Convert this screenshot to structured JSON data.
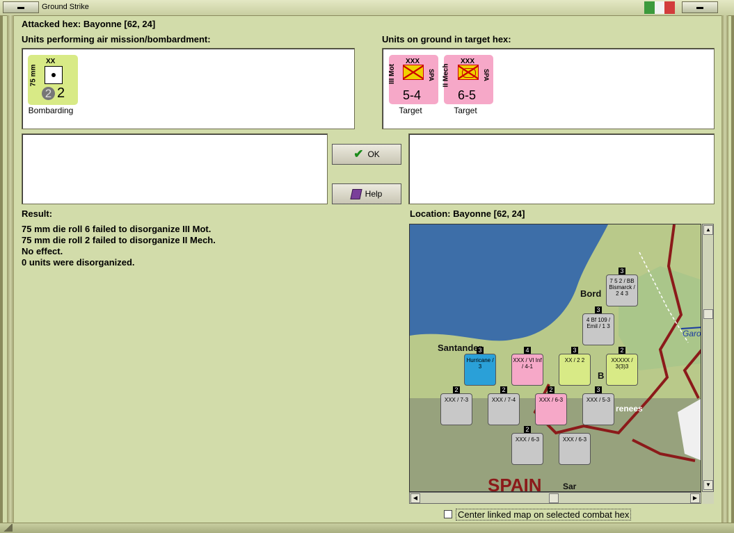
{
  "window": {
    "title": "Ground Strike"
  },
  "header": {
    "attacked_hex": "Attacked hex: Bayonne  [62, 24]"
  },
  "air_panel": {
    "label": "Units performing air mission/bombardment:",
    "units": [
      {
        "size": "XX",
        "side_label": "75 mm",
        "value_circle": "2",
        "value": "2",
        "caption": "Bombarding",
        "color": "#d8ea86"
      }
    ]
  },
  "ground_panel": {
    "label": "Units on ground in target hex:",
    "units": [
      {
        "size": "XXX",
        "name": "III Mot",
        "nation": "SPA",
        "combat": "5-4",
        "caption": "Target",
        "color": "#f6a8c8"
      },
      {
        "size": "XXX",
        "name": "II Mech",
        "nation": "SPA",
        "combat": "6-5",
        "caption": "Target",
        "color": "#f6a8c8"
      }
    ]
  },
  "buttons": {
    "ok": "OK",
    "help": "Help"
  },
  "result": {
    "label": "Result:",
    "lines": [
      "75 mm die roll 6 failed to disorganize III Mot.",
      "75 mm die roll 2 failed to disorganize II Mech.",
      "No effect.",
      "0 units were disorganized."
    ]
  },
  "location": {
    "label": "Location:  Bayonne  [62, 24]",
    "map_labels": {
      "bordeaux": "Bord",
      "santander": "Santander",
      "pyrenees": "renees",
      "spain": "SPAIN",
      "garonne": "Garo",
      "sar": "Sar",
      "b": "B"
    },
    "map_units": [
      {
        "top": "3",
        "text": "7 5 2 / BB Bismarck / 2 4 3",
        "color": "#c8c8c8"
      },
      {
        "top": "3",
        "text": "4 Bf 109 / Emil / 1 3",
        "color": "#c8c8c8"
      },
      {
        "top": "3",
        "text": "Hurricane / 3",
        "color": "#2aa0d8"
      },
      {
        "top": "4",
        "text": "XXX / VI Inf / 4-1",
        "color": "#f6a8c8"
      },
      {
        "top": "3",
        "text": "XX / 2 2",
        "color": "#d8ea86"
      },
      {
        "top": "2",
        "text": "XXXXX / 3(3)3",
        "color": "#d8ea86"
      },
      {
        "top": "2",
        "text": "XXX / 7-3",
        "color": "#c8c8c8"
      },
      {
        "top": "2",
        "text": "XXX / 7-4",
        "color": "#c8c8c8"
      },
      {
        "top": "2",
        "text": "XXX / 6-3",
        "color": "#f6a8c8"
      },
      {
        "top": "3",
        "text": "XXX / 5-3",
        "color": "#c8c8c8"
      },
      {
        "top": "2",
        "text": "XXX / 6-3",
        "color": "#c8c8c8"
      },
      {
        "top": "",
        "text": "XXX / 6-3",
        "color": "#c8c8c8"
      }
    ]
  },
  "footer": {
    "center_checkbox": "Center linked map on selected combat hex"
  },
  "colors": {
    "background": "#d2dcaa",
    "unit_pink": "#f6a8c8",
    "unit_green": "#d8ea86",
    "sea": "#3d6ea8"
  }
}
